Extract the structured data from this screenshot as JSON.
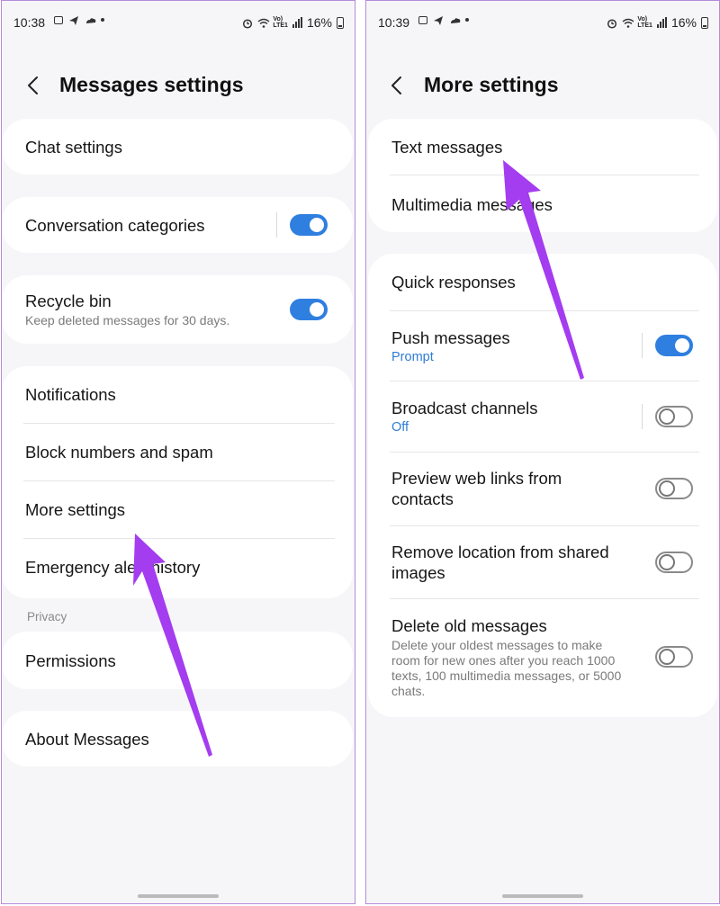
{
  "colors": {
    "accent": "#2f7fe0",
    "arrow": "#a43cf0",
    "link_blue": "#2f7dd6"
  },
  "screen1": {
    "status": {
      "time": "10:38",
      "battery": "16%"
    },
    "title": "Messages settings",
    "items": {
      "chat_settings": "Chat settings",
      "conversation_categories": "Conversation categories",
      "recycle_bin": "Recycle bin",
      "recycle_bin_sub": "Keep deleted messages for 30 days.",
      "notifications": "Notifications",
      "block_numbers": "Block numbers and spam",
      "more_settings": "More settings",
      "emergency": "Emergency alert history",
      "privacy_header": "Privacy",
      "permissions": "Permissions",
      "about": "About Messages"
    },
    "toggles": {
      "conversation_categories": true,
      "recycle_bin": true
    }
  },
  "screen2": {
    "status": {
      "time": "10:39",
      "battery": "16%"
    },
    "title": "More settings",
    "items": {
      "text_messages": "Text messages",
      "multimedia_messages": "Multimedia messages",
      "quick_responses": "Quick responses",
      "push_messages": "Push messages",
      "push_messages_sub": "Prompt",
      "broadcast_channels": "Broadcast channels",
      "broadcast_channels_sub": "Off",
      "preview_links_1": "Preview web links from",
      "preview_links_2": "contacts",
      "remove_location_1": "Remove location from shared",
      "remove_location_2": "images",
      "delete_old": "Delete old messages",
      "delete_old_sub_1": "Delete your oldest messages to make",
      "delete_old_sub_2": "room for new ones after you reach 1000",
      "delete_old_sub_3": "texts, 100 multimedia messages, or 5000",
      "delete_old_sub_4": "chats."
    },
    "toggles": {
      "push_messages": true,
      "broadcast_channels": false,
      "preview_links": false,
      "remove_location": false,
      "delete_old": false
    }
  }
}
